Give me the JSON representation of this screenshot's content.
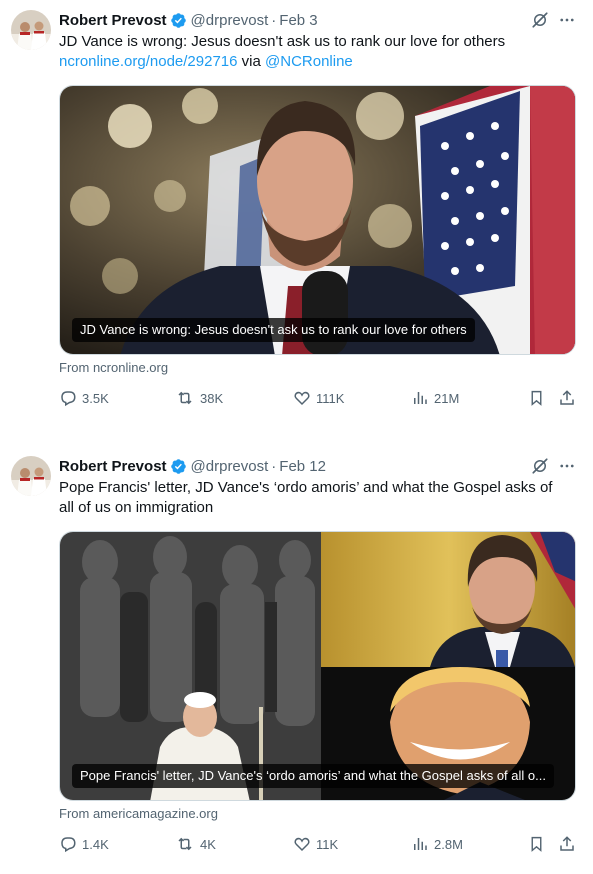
{
  "tweets": [
    {
      "author": "Robert Prevost",
      "handle": "@drprevost",
      "separator": "·",
      "date": "Feb 3",
      "text_line1": "JD Vance is wrong: Jesus doesn't ask us to rank our love for others",
      "link": "ncronline.org/node/292716",
      "via": "via",
      "mention": "@NCRonline",
      "card_caption": "JD Vance is wrong: Jesus doesn't ask us to rank our love for others",
      "from": "From ncronline.org",
      "replies": "3.5K",
      "reposts": "38K",
      "likes": "111K",
      "views": "21M"
    },
    {
      "author": "Robert Prevost",
      "handle": "@drprevost",
      "separator": "·",
      "date": "Feb 12",
      "text_line1": "Pope Francis' letter, JD Vance's ‘ordo amoris’ and what the Gospel asks of",
      "text_line2": "all of us on immigration",
      "card_caption": "Pope Francis' letter, JD Vance's ‘ordo amoris’ and what the Gospel asks of all o...",
      "from": "From americamagazine.org",
      "replies": "1.4K",
      "reposts": "4K",
      "likes": "11K",
      "views": "2.8M"
    }
  ],
  "icons": [
    "verified-badge-icon",
    "grok-icon",
    "more-icon",
    "reply-icon",
    "repost-icon",
    "like-icon",
    "views-icon",
    "bookmark-icon",
    "share-icon"
  ],
  "colors": {
    "text": "#0f1419",
    "secondary": "#536471",
    "link": "#1d9bf0",
    "verified": "#1d9bf0"
  }
}
